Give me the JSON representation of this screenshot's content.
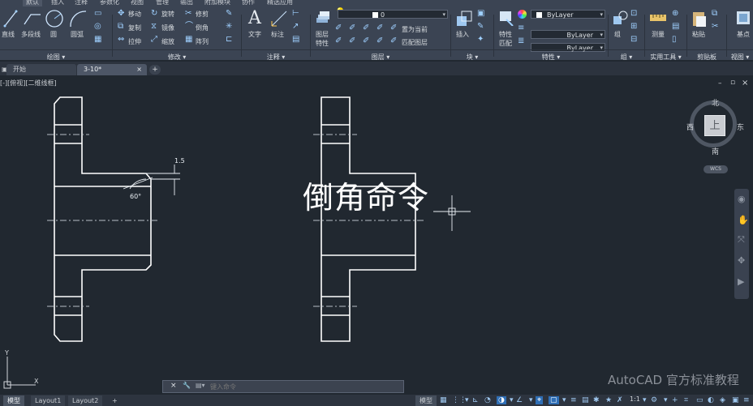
{
  "menubar": {
    "tabs": [
      "默认",
      "插入",
      "注释",
      "参数化",
      "视图",
      "管理",
      "输出",
      "附加模块",
      "协作",
      "精选应用"
    ]
  },
  "ribbon": {
    "draw": {
      "line": "直线",
      "polyline": "多段线",
      "circle": "圆",
      "arc": "圆弧",
      "panel_title": "绘图 ▾"
    },
    "modify": {
      "move": "移动",
      "rotate": "旋转",
      "trim": "修剪",
      "copy": "复制",
      "mirror": "镜像",
      "fillet": "倒角",
      "stretch": "拉伸",
      "scale": "缩放",
      "array": "阵列",
      "panel_title": "修改 ▾"
    },
    "annotation": {
      "text": "文字",
      "dimension": "标注",
      "panel_title": "注释 ▾"
    },
    "layers": {
      "layer_props": "图层\n特性",
      "layer_props_l1": "图层",
      "layer_props_l2": "特性",
      "current_layer": "0",
      "set_current": "置为当前",
      "match_layer": "匹配图层",
      "panel_title": "图层 ▾"
    },
    "block": {
      "insert": "插入",
      "panel_title": "块 ▾"
    },
    "properties": {
      "match_l1": "特性",
      "match_l2": "匹配",
      "color": "ByLayer",
      "linetype": "ByLayer",
      "lineweight": "ByLayer",
      "panel_title": "特性 ▾"
    },
    "groups": {
      "group": "组",
      "panel_title": "组 ▾"
    },
    "utilities": {
      "measure": "测量",
      "panel_title": "实用工具 ▾"
    },
    "clipboard": {
      "paste": "粘贴",
      "panel_title": "剪贴板"
    },
    "view": {
      "base": "基点",
      "panel_title": "视图 ▾"
    }
  },
  "doc_tabs": {
    "start": "开始",
    "file": "3-10*",
    "close": "×",
    "add": "+"
  },
  "viewport": {
    "label": "[-][俯视][二维线框]",
    "overlay_title": "倒角命令",
    "dim_value": "1.5",
    "angle_value": "60°",
    "compass": {
      "north": "北",
      "south": "南",
      "east": "东",
      "west": "西",
      "top": "上",
      "wcs": "WCS"
    },
    "ucs_y": "Y",
    "ucs_x": "X",
    "window_controls": {
      "minimize": "–",
      "restore": "▫",
      "close": "×"
    }
  },
  "watermark": "AutoCAD 官方标准教程",
  "command_line": {
    "placeholder": "键入命令",
    "close": "×",
    "settings": "🔧"
  },
  "status": {
    "layout_tabs": [
      "模型",
      "Layout1",
      "Layout2",
      "+"
    ],
    "model_label": "模型",
    "scale": "1:1"
  }
}
